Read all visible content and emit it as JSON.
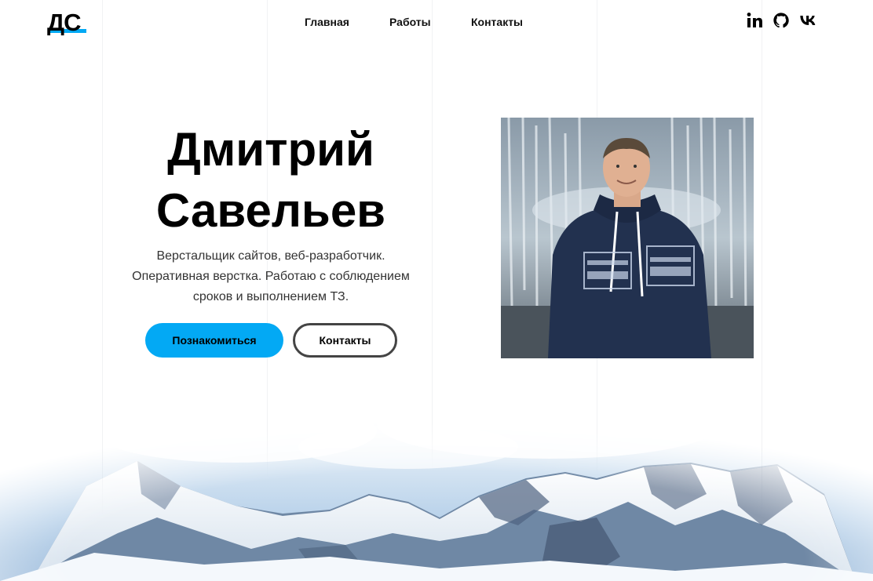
{
  "header": {
    "logo": "ДС",
    "nav": [
      {
        "label": "Главная"
      },
      {
        "label": "Работы"
      },
      {
        "label": "Контакты"
      }
    ],
    "socials": [
      {
        "icon": "linkedin-icon"
      },
      {
        "icon": "github-icon"
      },
      {
        "icon": "vk-icon"
      }
    ]
  },
  "hero": {
    "first_name": "Дмитрий",
    "last_name": "Савельев",
    "description": "Верстальщик сайтов, веб-разработчик. Оперативная верстка. Работаю с соблюдением сроков и выполнением ТЗ.",
    "primary_button": "Познакомиться",
    "secondary_button": "Контакты",
    "photo_alt_icon": "portrait-photo"
  },
  "colors": {
    "accent": "#03a9f4",
    "text": "#000000",
    "secondary_text": "#333333",
    "button_border": "#444444"
  }
}
